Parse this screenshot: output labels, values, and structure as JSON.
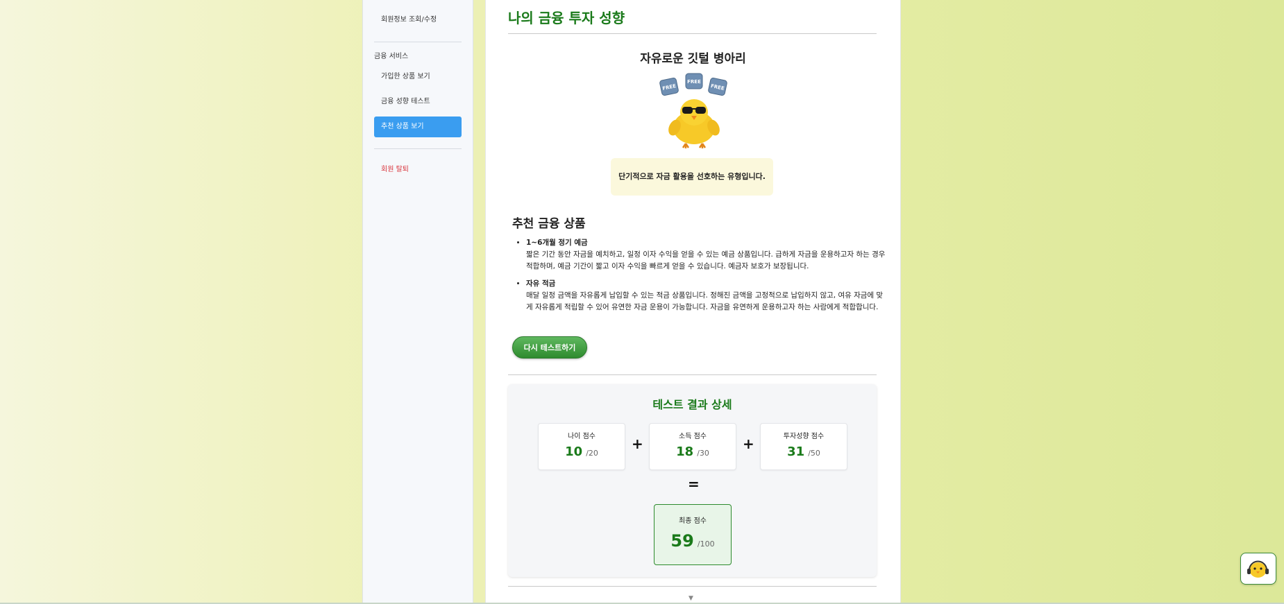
{
  "sidebar": {
    "items": [
      {
        "label": "회원정보 조회/수정"
      },
      {
        "label": "가입한 상품 보기"
      },
      {
        "label": "금융 성향 테스트"
      },
      {
        "label": "추천 상품 보기"
      },
      {
        "label": "회원 탈퇴"
      }
    ],
    "section_label": "금융 서비스"
  },
  "main": {
    "title": "나의 금융 투자 성향",
    "type_name": "자유로운 깃털 병아리",
    "type_description": "단기적으로 자금 활용을 선호하는 유형입니다.",
    "mascot_badges": [
      "FREE",
      "FREE",
      "FREE"
    ],
    "recommendation_title": "추천 금융 상품",
    "recommendations": [
      {
        "name": "1~6개월 정기 예금",
        "description": "짧은 기간 동안 자금을 예치하고, 일정 이자 수익을 얻을 수 있는 예금 상품입니다. 급하게 자금을 운용하고자 하는 경우 적합하며, 예금 기간이 짧고 이자 수익을 빠르게 얻을 수 있습니다. 예금자 보호가 보장됩니다."
      },
      {
        "name": "자유 적금",
        "description": "매달 일정 금액을 자유롭게 납입할 수 있는 적금 상품입니다. 정해진 금액을 고정적으로 납입하지 않고, 여유 자금에 맞게 자유롭게 적립할 수 있어 유연한 자금 운용이 가능합니다. 자금을 유연하게 운용하고자 하는 사람에게 적합합니다."
      }
    ],
    "retest_label": "다시 테스트하기"
  },
  "detail": {
    "title": "테스트 결과 상세",
    "scores": [
      {
        "label": "나이 점수",
        "value": "10",
        "max": "/20"
      },
      {
        "label": "소득 점수",
        "value": "18",
        "max": "/30"
      },
      {
        "label": "투자성향 점수",
        "value": "31",
        "max": "/50"
      }
    ],
    "plus": "+",
    "equals": "=",
    "final": {
      "label": "최종 점수",
      "value": "59",
      "max": "/100"
    }
  },
  "scroll_indicator": "▼",
  "colors": {
    "accent_green": "#1a7a1a",
    "active_blue": "#3a9df0",
    "danger_red": "#d9363e"
  }
}
